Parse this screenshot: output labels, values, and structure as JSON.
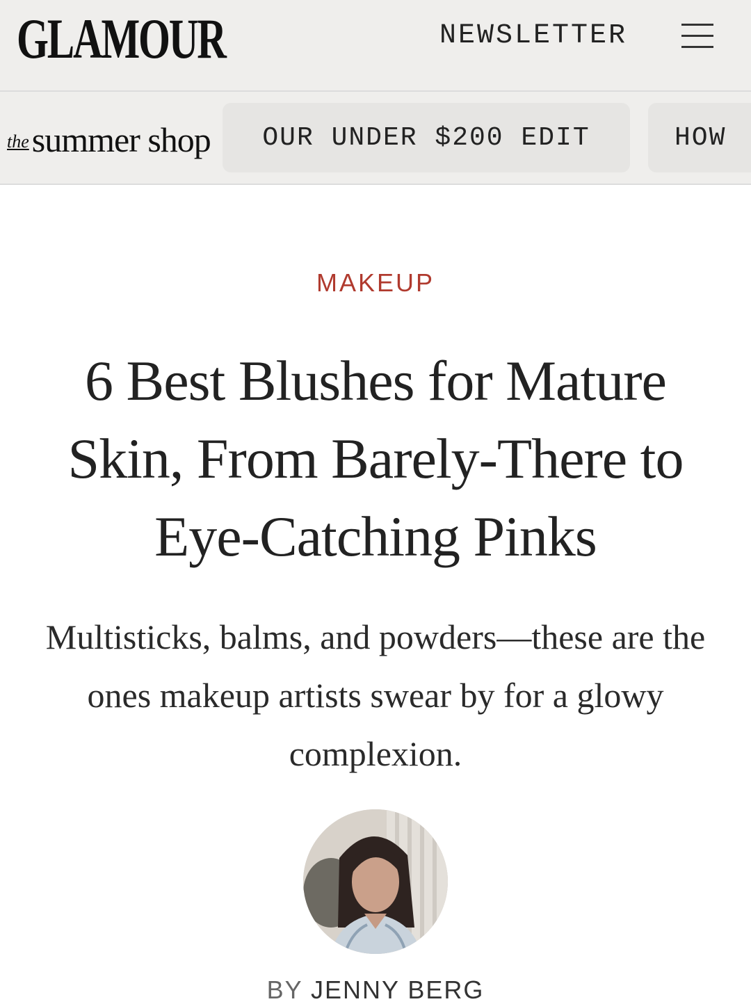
{
  "header": {
    "logo": "GLAMOUR",
    "newsletter_label": "NEWSLETTER",
    "menu_icon": "hamburger-menu-icon"
  },
  "subnav": {
    "promo_prefix": "the",
    "promo_main": "summer shop",
    "items": [
      {
        "label": "OUR UNDER $200 EDIT"
      },
      {
        "label": "HOW"
      }
    ]
  },
  "article": {
    "category": "MAKEUP",
    "title": "6 Best Blushes for Mature Skin, From Barely-There to Eye-Catching Pinks",
    "dek": "Multisticks, balms, and powders—these are the ones makeup artists swear by for a glowy complexion.",
    "byline_prefix": "BY",
    "author": "JENNY BERG"
  },
  "colors": {
    "accent": "#b03a2e",
    "header_bg": "#efeeec",
    "chip_bg": "#e6e5e3"
  }
}
